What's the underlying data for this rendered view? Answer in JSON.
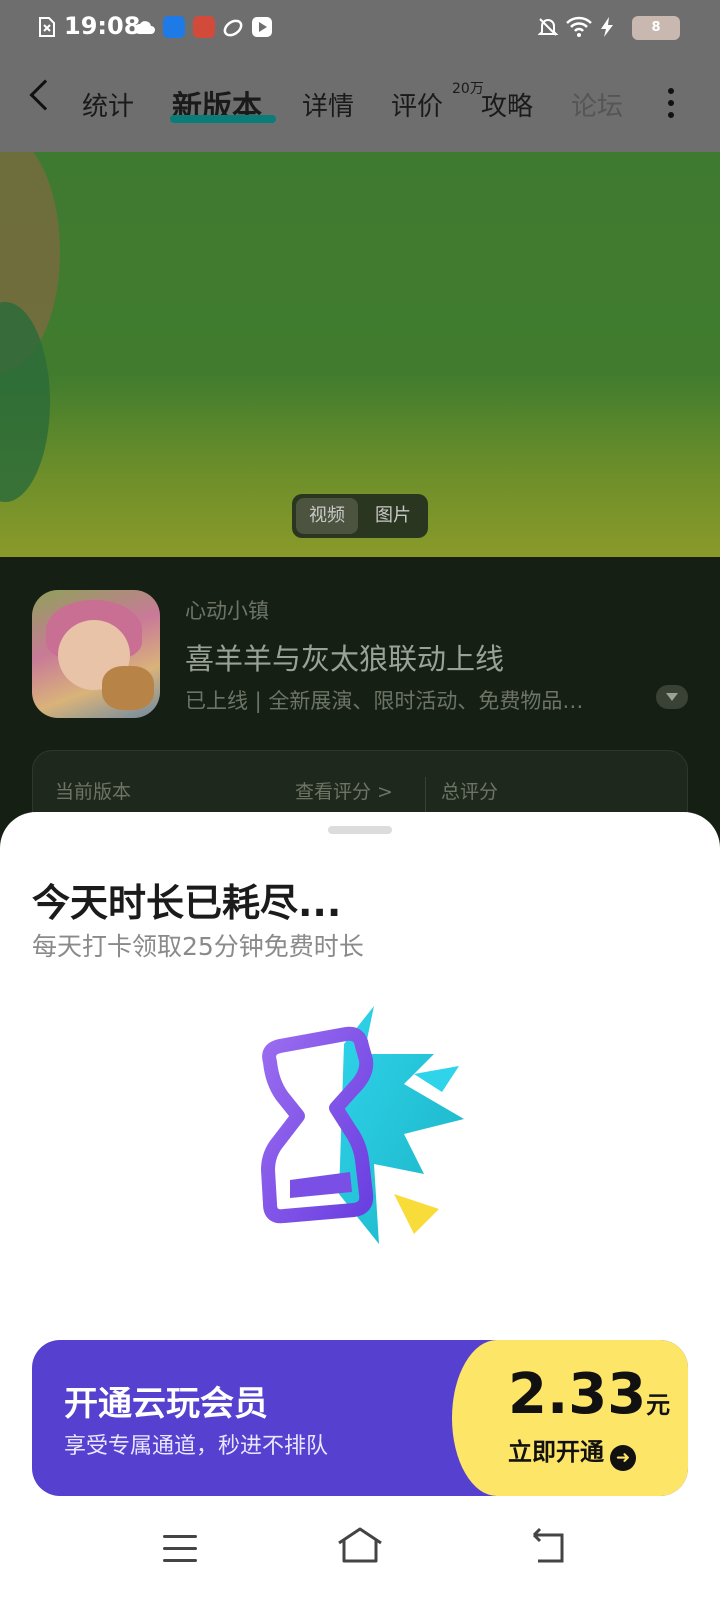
{
  "status_bar": {
    "time": "19:08",
    "battery_level": "8",
    "icons": [
      "sim-error-icon",
      "weather-cloud-icon",
      "app-notify-icon",
      "game-app-icon",
      "link-icon",
      "video-app-icon",
      "mute-notification-icon",
      "wifi-icon",
      "charging-icon",
      "battery-icon"
    ]
  },
  "nav": {
    "tabs": [
      {
        "label": "统计"
      },
      {
        "label": "新版本"
      },
      {
        "label": "详情"
      },
      {
        "label": "评价"
      },
      {
        "label": "攻略"
      },
      {
        "label": "论坛"
      }
    ],
    "active_tab": "新版本",
    "review_count_badge": "20万",
    "accent_color": "#0a7d78"
  },
  "media_toggle": {
    "video_label": "视频",
    "image_label": "图片",
    "selected": "视频"
  },
  "game": {
    "developer": "心动小镇",
    "title": "喜羊羊与灰太狼联动上线",
    "subtitle": "已上线 | 全新展演、限时活动、免费物品…"
  },
  "score_card": {
    "current_version_label": "当前版本",
    "view_ratings_label": "查看评分 >",
    "total_rating_label": "总评分"
  },
  "sheet": {
    "title": "今天时长已耗尽...",
    "subtitle": "每天打卡领取25分钟免费时长",
    "illustration_icon": "hourglass-burst-icon"
  },
  "vip_banner": {
    "title": "开通云玩会员",
    "subtitle": "享受专属通道，秒进不排队",
    "price": "2.33",
    "price_unit": "元",
    "cta_label": "立即开通",
    "colors": {
      "primary": "#5540d0",
      "highlight": "#fde567"
    }
  },
  "system_nav": {
    "icons": [
      "menu-icon",
      "home-icon",
      "back-icon"
    ]
  }
}
